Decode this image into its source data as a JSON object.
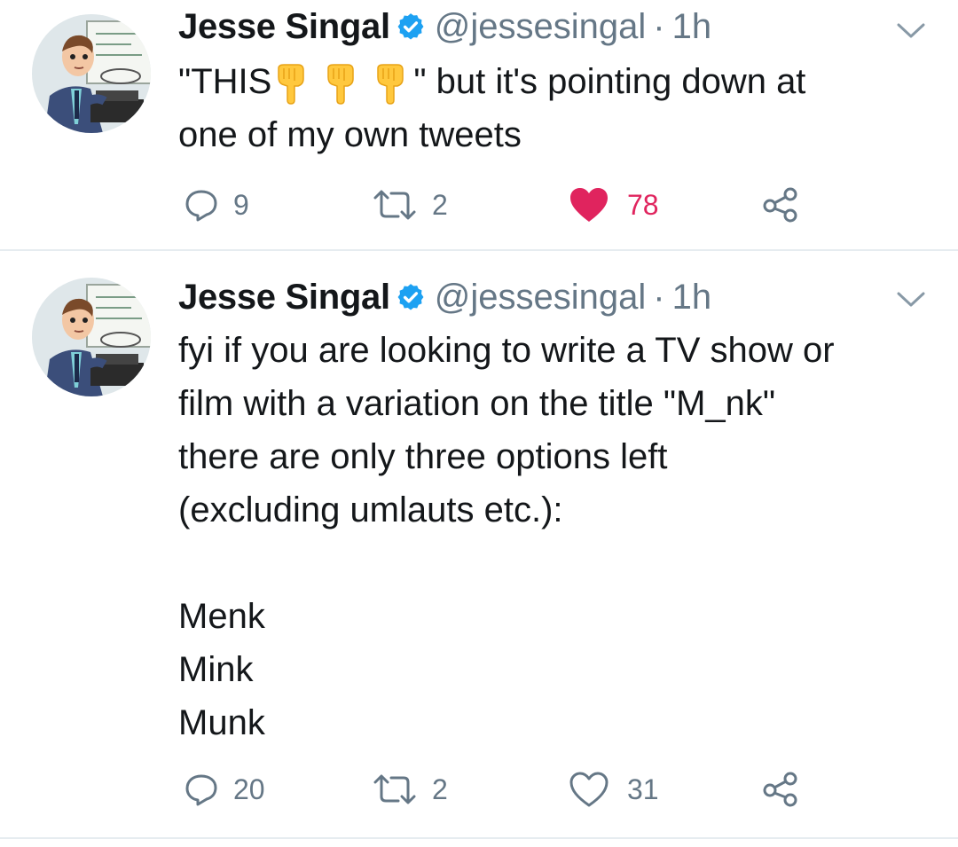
{
  "tweets": [
    {
      "author": "Jesse Singal",
      "handle": "@jessesingal",
      "time": "1h",
      "text_before": "\"THIS",
      "text_after": "\" but it's pointing down at",
      "text_line2": "one of my own tweets",
      "emoji_name": "backhand-index-pointing-down",
      "replies": "9",
      "retweets": "2",
      "likes": "78",
      "liked": true
    },
    {
      "author": "Jesse Singal",
      "handle": "@jessesingal",
      "time": "1h",
      "lines": [
        "fyi if you are looking to write a TV show or",
        "film with a variation on the title \"M_nk\"",
        "there are only three options left",
        "(excluding umlauts etc.):",
        "",
        "Menk",
        "Mink",
        "Munk"
      ],
      "replies": "20",
      "retweets": "2",
      "likes": "31",
      "liked": false
    }
  ],
  "colors": {
    "verified": "#1da1f2",
    "like_active": "#e0245e",
    "meta_gray": "#657786",
    "divider": "#e6ecf0"
  },
  "icons": [
    "verified-badge-icon",
    "chevron-down-icon",
    "reply-icon",
    "retweet-icon",
    "heart-icon",
    "share-icon"
  ]
}
